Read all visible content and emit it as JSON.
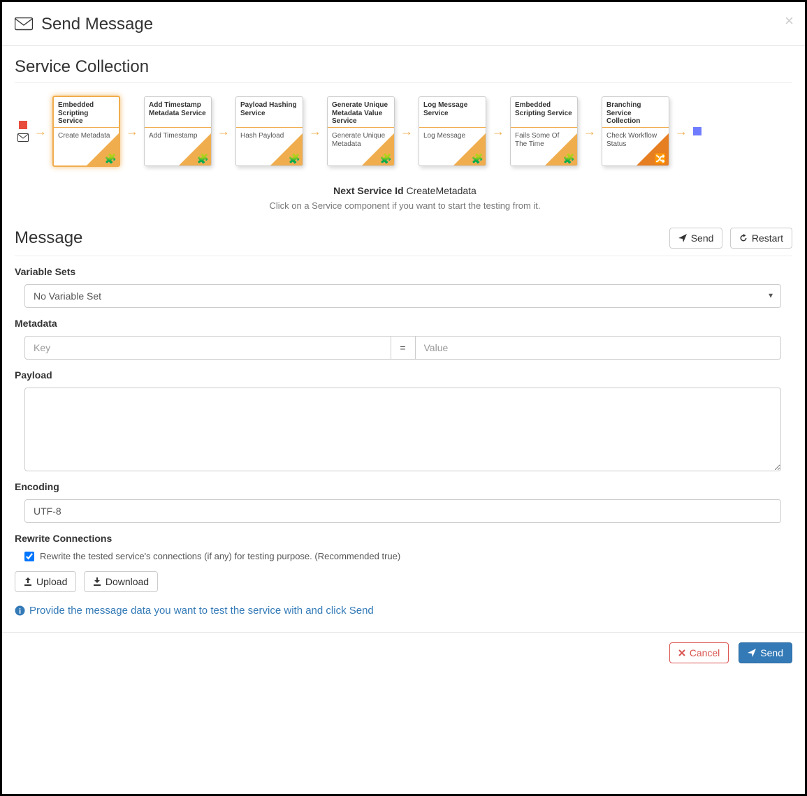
{
  "header": {
    "title": "Send Message"
  },
  "service_collection": {
    "heading": "Service Collection",
    "next_service_label": "Next Service Id",
    "next_service_value": "CreateMetadata",
    "hint": "Click on a Service component if you want to start the testing from it.",
    "cards": [
      {
        "type": "Embedded Scripting Service",
        "name": "Create Metadata",
        "selected": true
      },
      {
        "type": "Add Timestamp Metadata Service",
        "name": "Add Timestamp",
        "selected": false
      },
      {
        "type": "Payload Hashing Service",
        "name": "Hash Payload",
        "selected": false
      },
      {
        "type": "Generate Unique Metadata Value Service",
        "name": "Generate Unique Metadata",
        "selected": false
      },
      {
        "type": "Log Message Service",
        "name": "Log Message",
        "selected": false
      },
      {
        "type": "Embedded Scripting Service",
        "name": "Fails Some Of The Time",
        "selected": false
      },
      {
        "type": "Branching Service Collection",
        "name": "Check Workflow Status",
        "selected": false,
        "branch": true
      }
    ]
  },
  "message": {
    "heading": "Message",
    "send_label": "Send",
    "restart_label": "Restart",
    "variable_sets_label": "Variable Sets",
    "variable_sets_value": "No Variable Set",
    "metadata_label": "Metadata",
    "key_ph": "Key",
    "eq": "=",
    "value_ph": "Value",
    "payload_label": "Payload",
    "payload_value": "",
    "encoding_label": "Encoding",
    "encoding_value": "UTF-8",
    "rewrite_label": "Rewrite Connections",
    "rewrite_desc": "Rewrite the tested service's connections (if any) for testing purpose. (Recommended true)",
    "rewrite_checked": true,
    "upload_label": "Upload",
    "download_label": "Download",
    "info": "Provide the message data you want to test the service with and click Send"
  },
  "footer": {
    "cancel_label": "Cancel",
    "send_label": "Send"
  }
}
